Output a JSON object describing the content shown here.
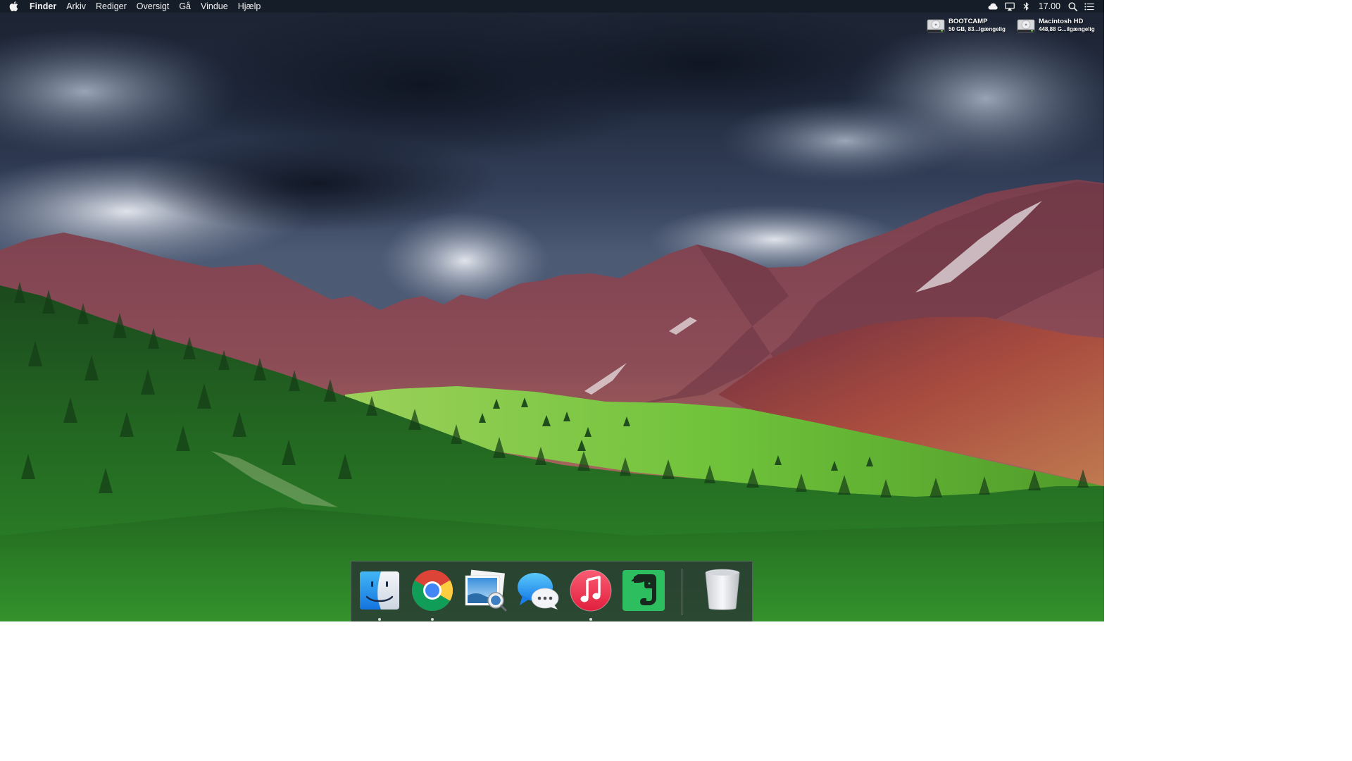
{
  "menubar": {
    "app_name": "Finder",
    "items": [
      "Arkiv",
      "Rediger",
      "Oversigt",
      "Gå",
      "Vindue",
      "Hjælp"
    ],
    "clock": "17.00",
    "status_icons": [
      "creative-cloud-icon",
      "airplay-icon",
      "bluetooth-icon",
      "spotlight-search-icon",
      "notification-center-icon"
    ]
  },
  "drives": [
    {
      "name": "BOOTCAMP",
      "info": "50 GB, 83...lgængelig"
    },
    {
      "name": "Macintosh HD",
      "info": "448,88 G...ilgængelig"
    }
  ],
  "dock": {
    "apps": [
      {
        "name": "finder-icon",
        "running": true
      },
      {
        "name": "chrome-icon",
        "running": true
      },
      {
        "name": "preview-icon",
        "running": false
      },
      {
        "name": "messages-icon",
        "running": false
      },
      {
        "name": "itunes-icon",
        "running": true
      },
      {
        "name": "evernote-icon",
        "running": false
      }
    ],
    "trash": "trash-icon"
  },
  "colors": {
    "menubar_bg": "#141c28",
    "sky_dark": "#1b2436",
    "mountain": "#8a4a52",
    "meadow": "#7cc23a",
    "forest": "#1f5a1c"
  }
}
